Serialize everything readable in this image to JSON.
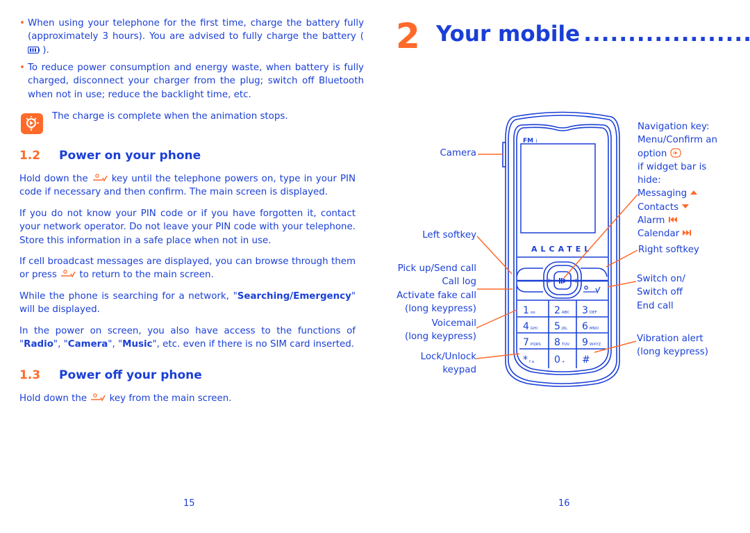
{
  "left_page": {
    "bullets": [
      "When using your telephone for the first time, charge the battery fully (approximately 3 hours). You are advised to fully charge the battery (",
      "To reduce power consumption and energy waste, when battery is fully charged, disconnect your charger from the plug; switch off Bluetooth when not in use; reduce the backlight time, etc."
    ],
    "bullet1_end": ").",
    "tip": {
      "icon": "lightbulb-tip-icon",
      "text": "The charge is complete when the animation stops."
    },
    "section_1_2": {
      "number": "1.2",
      "title": "Power on your phone",
      "p1_a": "Hold down the",
      "p1_b": "key until the telephone powers on, type in your PIN code if necessary and then confirm. The main screen is displayed.",
      "p2": "If you do not know your PIN code or if you have forgotten it, contact your network operator. Do not leave your PIN code with your telephone. Store this information in a safe place when not in use.",
      "p3_a": "If cell broadcast messages are displayed, you can browse through them or press",
      "p3_b": "to return to the main screen.",
      "p4_a": "While the phone is searching for a network, \"",
      "p4_bold": "Searching/Emergency",
      "p4_b": "\" will be displayed.",
      "p5_a": "In the power on screen, you also have access to the functions of \"",
      "p5_radio": "Radio",
      "p5_b": "\", \"",
      "p5_camera": "Camera",
      "p5_c": "\", \"",
      "p5_music": "Music",
      "p5_d": "\", etc. even if there is no SIM card inserted."
    },
    "section_1_3": {
      "number": "1.3",
      "title": "Power off your phone",
      "p1_a": "Hold down the",
      "p1_b": "key from the main screen."
    },
    "page_number": "15"
  },
  "right_page": {
    "chapter_number": "2",
    "chapter_title": "Your mobile",
    "chapter_dots": "........................",
    "phone": {
      "brand": "ALCATEL",
      "screen_indicator": "FM",
      "keys": [
        {
          "digit": "1",
          "letters": "oo"
        },
        {
          "digit": "2",
          "letters": "ABC"
        },
        {
          "digit": "3",
          "letters": "DEF"
        },
        {
          "digit": "4",
          "letters": "GHI"
        },
        {
          "digit": "5",
          "letters": "JKL"
        },
        {
          "digit": "6",
          "letters": "MNO"
        },
        {
          "digit": "7",
          "letters": "PQRS"
        },
        {
          "digit": "8",
          "letters": "TUV"
        },
        {
          "digit": "9",
          "letters": "WXYZ"
        },
        {
          "digit": "*",
          "letters": "f a"
        },
        {
          "digit": "0",
          "letters": "+"
        },
        {
          "digit": "#",
          "letters": ""
        }
      ]
    },
    "labels_left": {
      "camera": "Camera",
      "left_softkey": "Left softkey",
      "pickup_1": "Pick up/Send call",
      "pickup_2": "Call log",
      "pickup_3": "Activate fake call",
      "pickup_4": "(long keypress)",
      "voicemail_1": "Voicemail",
      "voicemail_2": "(long keypress)",
      "lock_1": "Lock/Unlock",
      "lock_2": "keypad"
    },
    "labels_right": {
      "nav_1": "Navigation key:",
      "nav_2": "Menu/Confirm an",
      "nav_3": "option",
      "nav_4": "if widget bar is",
      "nav_5": "hide:",
      "messaging": "Messaging",
      "contacts": "Contacts",
      "alarm": "Alarm",
      "calendar": "Calendar",
      "right_softkey": "Right softkey",
      "switch_1": "Switch on/",
      "switch_2": "Switch off",
      "switch_3": "End call",
      "vibration_1": "Vibration alert",
      "vibration_2": "(long keypress)"
    },
    "page_number": "16"
  },
  "colors": {
    "text_blue": "#1a3fd6",
    "accent_orange": "#ff6a2a"
  }
}
